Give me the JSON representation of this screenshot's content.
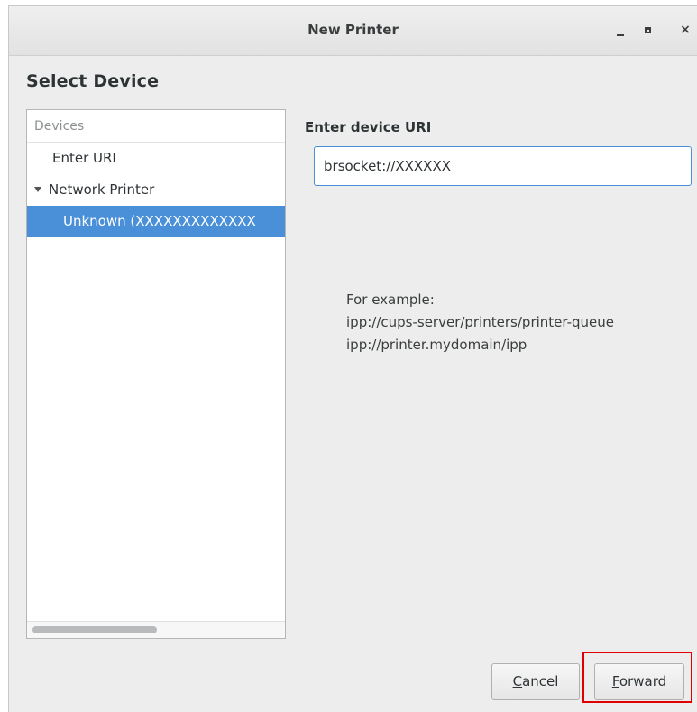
{
  "window": {
    "title": "New Printer",
    "controls": {
      "minimize_icon": "minimize-icon",
      "maximize_icon": "maximize-icon",
      "close_icon": "close-icon",
      "close_glyph": "×"
    }
  },
  "page": {
    "heading": "Select Device"
  },
  "devices": {
    "header": "Devices",
    "items": [
      {
        "label": "Enter URI"
      },
      {
        "label": "Network Printer",
        "expanded": true
      },
      {
        "label": "Unknown (XXXXXXXXXXXXX",
        "selected": true
      }
    ]
  },
  "uri": {
    "label": "Enter device URI",
    "value": "brsocket://XXXXXX",
    "example_lines": [
      "For example:",
      "ipp://cups-server/printers/printer-queue",
      "ipp://printer.mydomain/ipp"
    ]
  },
  "buttons": {
    "cancel_mnemonic": "C",
    "cancel_rest": "ancel",
    "forward_mnemonic": "F",
    "forward_rest": "orward"
  },
  "colors": {
    "selection": "#4a90d9",
    "highlight_box": "#e00000"
  }
}
